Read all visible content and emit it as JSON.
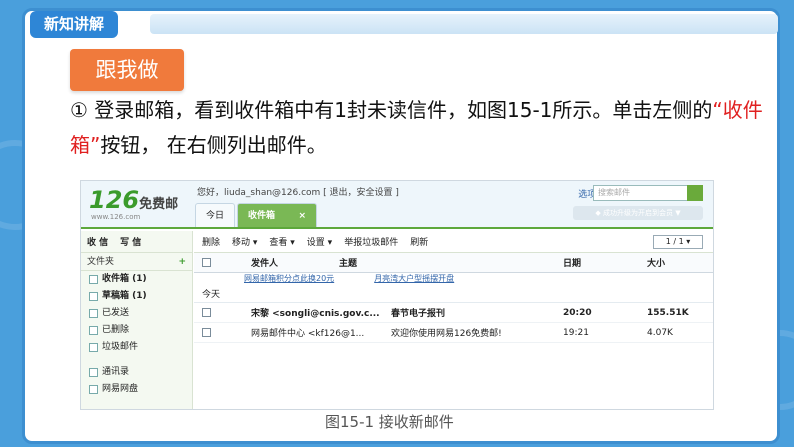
{
  "tag": "新知讲解",
  "step_button": "跟我做",
  "instruction": {
    "part1": "①  登录邮箱，看到收件箱中有1封未读信件，如图15-1所示。单击左侧的",
    "highlight": "“收件箱”",
    "part2": "按钮， 在右侧列出邮件。"
  },
  "mailbox": {
    "logo_num": "126",
    "logo_text": "免费邮",
    "logo_url": "www.126.com",
    "greeting": "您好，liuda_shan@126.com [ 退出，安全设置 ]",
    "tabs": [
      "今日",
      "收件箱"
    ],
    "tab_close": "×",
    "header_links": "选项 | 帮助",
    "search_placeholder": "搜索邮件",
    "sub_button": "◆ 成功升级为开启到会员 ▼",
    "side_actions": [
      "收 信",
      "写 信"
    ],
    "folder_head": "文件夹",
    "folder_plus": "+",
    "folders": [
      {
        "label": "收件箱 (1)",
        "bold": true
      },
      {
        "label": "草稿箱 (1)",
        "bold": false
      },
      {
        "label": "已发送",
        "bold": false
      },
      {
        "label": "已删除",
        "bold": false
      },
      {
        "label": "垃圾邮件",
        "bold": false
      }
    ],
    "extra_folders": [
      "通讯录",
      "网易网盘"
    ],
    "toolbar": [
      "删除",
      "移动 ▾",
      "查看 ▾",
      "设置 ▾",
      "举报垃圾邮件",
      "刷新"
    ],
    "pager": "1 / 1 ▾",
    "columns": [
      "发件人",
      "主题",
      "日期",
      "大小"
    ],
    "ads": [
      "网易邮箱积分点此换20元",
      "月亮湾大户型摇摆开盘"
    ],
    "group_label": "今天",
    "mails": [
      {
        "sender": "宋黎 <songli@cnis.gov.c...",
        "subject": "春节电子报刊",
        "date": "20:20",
        "size": "155.51K",
        "unread": true
      },
      {
        "sender": "网易邮件中心 <kf126@1...",
        "subject": "欢迎你使用网易126免费邮!",
        "date": "19:21",
        "size": "4.07K",
        "unread": false
      }
    ]
  },
  "caption": "图15-1  接收新邮件"
}
